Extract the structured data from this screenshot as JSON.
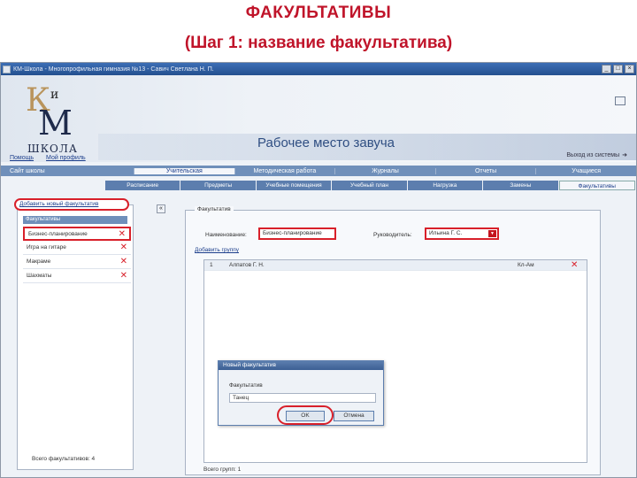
{
  "slide": {
    "title": "ФАКУЛЬТАТИВЫ",
    "subtitle": "(Шаг 1: название факультатива)"
  },
  "window": {
    "title": "КМ-Школа - Многопрофильная гимназия №13 - Савич Светлана Н. П.",
    "min": "_",
    "max": "□",
    "close": "×"
  },
  "header": {
    "logo_k": "К",
    "logo_i": "и",
    "logo_m": "М",
    "logo_school": "ШКОЛА",
    "workplace": "Рабочее место завуча",
    "exit": "Выход из системы"
  },
  "top_links": [
    "Помощь",
    "Мой профиль"
  ],
  "nav1": {
    "school": "Сайт школы",
    "tabs": [
      "Учительская",
      "Методическая работа",
      "Журналы",
      "Отчеты",
      "Учащиеся"
    ],
    "active": "Учительская"
  },
  "nav2": {
    "tabs": [
      "Расписание",
      "Предметы",
      "Учебные помещения",
      "Учебный план",
      "Нагрузка",
      "Замены",
      "Факультативы"
    ],
    "active": "Факультативы"
  },
  "left": {
    "add_button": "Добавить новый факультатив",
    "list_header": "Факультативы",
    "items": [
      "Бизнес-планирование",
      "Игра на гитаре",
      "Макраме",
      "Шахматы"
    ],
    "total": "Всего факультативов: 4"
  },
  "main": {
    "legend": "Факультатив",
    "name_label": "Наименование:",
    "name_value": "Бизнес-планирование",
    "head_label": "Руководитель:",
    "head_value": "Ильина Г. С.",
    "groups_link": "Добавить группу",
    "rows": [
      {
        "num": "1",
        "name": "Алпатов Г. Н.",
        "info": "Кл-Ам"
      }
    ],
    "footer": "Всего групп: 1"
  },
  "dialog": {
    "title": "Новый факультатив",
    "label": "Факультатив",
    "value": "Танец",
    "ok": "OK",
    "cancel": "Отмена"
  }
}
